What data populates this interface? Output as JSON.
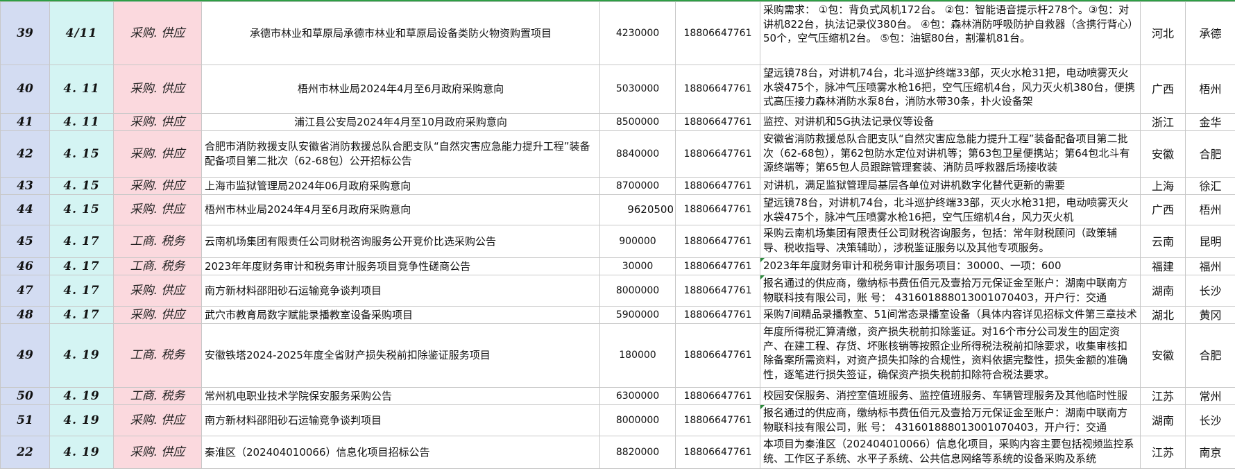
{
  "rows": [
    {
      "no": "39",
      "date": "4/11",
      "category": "采购. 供应",
      "project": "承德市林业和草原局承德市林业和草原局设备类防火物资购置项目",
      "amount": "4230000",
      "phone": "18806647761",
      "desc": "采购需求：  ①包：背负式风机172台。        ②包：智能语音提示杆278个。③包：对讲机822台，执法记录仪380台。      ④包：森林消防呼吸防护自救器（含携行背心）50个，空气压缩机2台。        ⑤包：油锯80台，割灌机81台。",
      "province": "河北",
      "city": "承德"
    },
    {
      "no": "40",
      "date": "4. 11",
      "category": "采购. 供应",
      "project": "梧州市林业局2024年4月至6月政府采购意向",
      "amount": "5030000",
      "phone": "18806647761",
      "desc": "望远镜78台，对讲机74台，北斗巡护终端33部，灭火水枪31把，电动喷雾灭火水袋475个，脉冲气压喷雾水枪16把，空气压缩机4台，风力灭火机380台，便携式高压接力森林消防水泵8台，消防水带30条，扑火设备架",
      "province": "广西",
      "city": "梧州"
    },
    {
      "no": "41",
      "date": "4. 11",
      "category": "采购. 供应",
      "project": "浦江县公安局2024年4月至10月政府采购意向",
      "amount": "8500000",
      "phone": "18806647761",
      "desc": "监控、对讲机和5G执法记录仪等设备",
      "province": "浙江",
      "city": "金华"
    },
    {
      "no": "42",
      "date": "4. 15",
      "category": "采购. 供应",
      "project": "合肥市消防救援支队安徽省消防救援总队合肥支队“自然灾害应急能力提升工程”装备配备项目第二批次（62-68包）公开招标公告",
      "amount": "8840000",
      "phone": "18806647761",
      "desc": "安徽省消防救援总队合肥支队“自然灾害应急能力提升工程”装备配备项目第二批次（62-68包），第62包防水定位对讲机等；第63包卫星便携站；第64包北斗有源终端等；第65包人员跟踪管理套装、消防员呼救器后场接收装",
      "province": "安徽",
      "city": "合肥"
    },
    {
      "no": "43",
      "date": "4. 15",
      "category": "采购. 供应",
      "project": "上海市监狱管理局2024年06月政府采购意向",
      "amount": "8700000",
      "phone": "18806647761",
      "desc": "对讲机，满足监狱管理局基层各单位对讲机数字化替代更新的需要",
      "province": "上海",
      "city": "徐汇"
    },
    {
      "no": "44",
      "date": "4. 15",
      "category": "采购. 供应",
      "project": "梧州市林业局2024年4月至6月政府采购意向",
      "amount": "9620500",
      "phone": "18806647761",
      "desc": "望远镜78台，对讲机74台，北斗巡护终端33部，灭火水枪31把，电动喷雾灭火水袋475个，脉冲气压喷雾水枪16把，空气压缩机4台，风力灭火机",
      "province": "广西",
      "city": "梧州"
    },
    {
      "no": "45",
      "date": "4. 17",
      "category": "工商. 税务",
      "project": "云南机场集团有限责任公司财税咨询服务公开竞价比选采购公告",
      "amount": "900000",
      "phone": "18806647761",
      "desc": "采购云南机场集团有限责任公司财税咨询服务，包括：常年财税顾问（政策辅导、税收指导、决策辅助），涉税鉴证服务以及其他专项服务。",
      "province": "云南",
      "city": "昆明"
    },
    {
      "no": "46",
      "date": "4. 17",
      "category": "工商. 税务",
      "project": "2023年年度财务审计和税务审计服务项目竞争性磋商公告",
      "amount": "30000",
      "phone": "18806647761",
      "desc": "2023年年度财务审计和税务审计服务项目：30000、一项：600",
      "province": "福建",
      "city": "福州"
    },
    {
      "no": "47",
      "date": "4. 17",
      "category": "采购. 供应",
      "project": "南方新材料邵阳砂石运输竞争谈判项目",
      "amount": "8000000",
      "phone": "18806647761",
      "desc": "报名通过的供应商，缴纳标书费伍佰元及壹拾万元保证金至账户：湖南中联南方物联科技有限公司，账 号： 43160188801300107040З，开户行：交通",
      "province": "湖南",
      "city": "长沙"
    },
    {
      "no": "48",
      "date": "4. 17",
      "category": "采购. 供应",
      "project": "武穴市教育局数字赋能录播教室设备采购项目",
      "amount": "5900000",
      "phone": "18806647761",
      "desc": "采购7间精品录播教室、51间常态录播室设备（具体内容详见招标文件第三章技术要求）",
      "province": "湖北",
      "city": "黄冈"
    },
    {
      "no": "49",
      "date": "4. 19",
      "category": "工商. 税务",
      "project": "安徽铁塔2024-2025年度全省财产损失税前扣除鉴证服务项目",
      "amount": "180000",
      "phone": "18806647761",
      "desc": "年度所得税汇算清缴，资产损失税前扣除鉴证。对16个市分公司发生的固定资产、在建工程、存货、坏账核销等按照企业所得税法税前扣除要求，收集审核扣除备案所需资料，对资产损失扣除的合规性，资料依据完整性，损失金额的准确性，逐笔进行损失签证，确保资产损失税前扣除符合税法要求。",
      "province": "安徽",
      "city": "合肥"
    },
    {
      "no": "50",
      "date": "4. 19",
      "category": "工商. 税务",
      "project": "常州机电职业技术学院保安服务采购公告",
      "amount": "6300000",
      "phone": "18806647761",
      "desc": "校园安保服务、消控室值班服务、监控值班服务、车辆管理服务及其他临时性服务",
      "province": "江苏",
      "city": "常州"
    },
    {
      "no": "51",
      "date": "4. 19",
      "category": "采购. 供应",
      "project": "南方新材料邵阳砂石运输竞争谈判项目",
      "amount": "8000000",
      "phone": "18806647761",
      "desc": "报名通过的供应商，缴纳标书费伍佰元及壹拾万元保证金至账户：湖南中联南方物联科技有限公司，账 号： 43160188801300107040З，开户行：交通",
      "province": "湖南",
      "city": "长沙"
    },
    {
      "no": "22",
      "date": "4. 19",
      "category": "采购. 供应",
      "project": "秦淮区（202404010066）信息化项目招标公告",
      "amount": "8820000",
      "phone": "18806647761",
      "desc": "本项目为秦淮区（202404010066）信息化项目，采购内容主要包括视频监控系统、工作区子系统、水平子系统、公共信息网络等系统的设备采购及系统",
      "province": "江苏",
      "city": "南京"
    }
  ]
}
